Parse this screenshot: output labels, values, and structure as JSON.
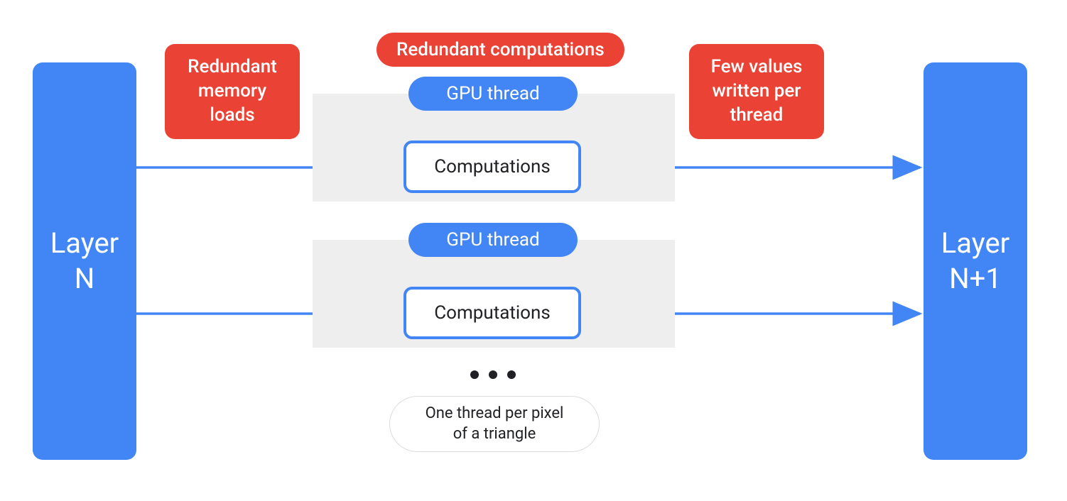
{
  "colors": {
    "blue": "#4285f4",
    "red": "#ea4335",
    "grey": "#eeeeee",
    "text": "#202124"
  },
  "layerN": {
    "label": "Layer\nN"
  },
  "layerN1": {
    "label": "Layer\nN+1"
  },
  "callouts": {
    "redundant_memory": "Redundant\nmemory\nloads",
    "redundant_computations": "Redundant computations",
    "few_values": "Few values\nwritten per\nthread"
  },
  "threads": [
    {
      "pill": "GPU thread",
      "box": "Computations"
    },
    {
      "pill": "GPU thread",
      "box": "Computations"
    }
  ],
  "footer": "One thread per pixel\nof a triangle"
}
